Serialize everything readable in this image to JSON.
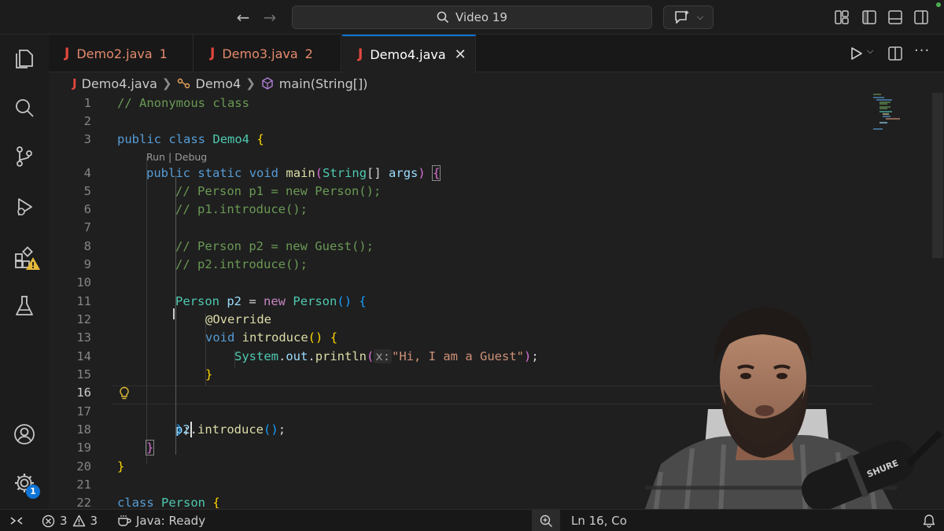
{
  "titlebar": {
    "search_text": "Video 19"
  },
  "tabs": [
    {
      "label": "Demo2.java",
      "count": "1"
    },
    {
      "label": "Demo3.java",
      "count": "2"
    },
    {
      "label": "Demo4.java",
      "count": ""
    }
  ],
  "breadcrumb": {
    "file": "Demo4.java",
    "class": "Demo4",
    "method": "main(String[])"
  },
  "editor": {
    "codelens": "Run | Debug",
    "current_line": "16",
    "lines": [
      {
        "n": "1"
      },
      {
        "n": "2"
      },
      {
        "n": "3"
      },
      {
        "n": "4"
      },
      {
        "n": "5"
      },
      {
        "n": "6"
      },
      {
        "n": "7"
      },
      {
        "n": "8"
      },
      {
        "n": "9"
      },
      {
        "n": "10"
      },
      {
        "n": "11"
      },
      {
        "n": "12"
      },
      {
        "n": "13"
      },
      {
        "n": "14"
      },
      {
        "n": "15"
      },
      {
        "n": "16"
      },
      {
        "n": "17"
      },
      {
        "n": "18"
      },
      {
        "n": "19"
      },
      {
        "n": "20"
      },
      {
        "n": "21"
      },
      {
        "n": "22"
      }
    ],
    "tokens": {
      "l1": "// Anonymous class",
      "l3_kw1": "public",
      "l3_kw2": "class",
      "l3_name": "Demo4",
      "l3_brace": "{",
      "l4_kw1": "public",
      "l4_kw2": "static",
      "l4_kw3": "void",
      "l4_fn": "main",
      "l4_type": "String",
      "l4_arr": "[]",
      "l4_var": "args",
      "l4_brace": "{",
      "l5": "// Person p1 = new Person();",
      "l6": "// p1.introduce();",
      "l8": "// Person p2 = new Guest();",
      "l9": "// p2.introduce();",
      "l11_type": "Person",
      "l11_var": "p2",
      "l11_eq": " = ",
      "l11_new": "new",
      "l11_type2": "Person",
      "l11_brace": "{",
      "l12_ann": "@Override",
      "l13_kw": "void",
      "l13_fn": "introduce",
      "l13_brace": "{",
      "l14_sys": "System",
      "l14_out": "out",
      "l14_fn": "println",
      "l14_hint": "x:",
      "l14_str": "\"Hi, I am a Guest\"",
      "l15_brace": "}",
      "l16_brace": "}",
      "l16_semi": ";",
      "l18_var": "p2",
      "l18_fn": "introduce",
      "l19_brace": "}",
      "l20_brace": "}",
      "l22_kw": "class",
      "l22_name": "Person",
      "l22_brace": "{"
    }
  },
  "statusbar": {
    "errors": "3",
    "warnings": "3",
    "java_status": "Java: Ready",
    "position": "Ln 16, Co"
  },
  "activity": {
    "settings_badge": "1"
  },
  "colors": {
    "accent": "#0e74d6",
    "java_icon": "#e2483d",
    "warning": "#e5b93a"
  }
}
